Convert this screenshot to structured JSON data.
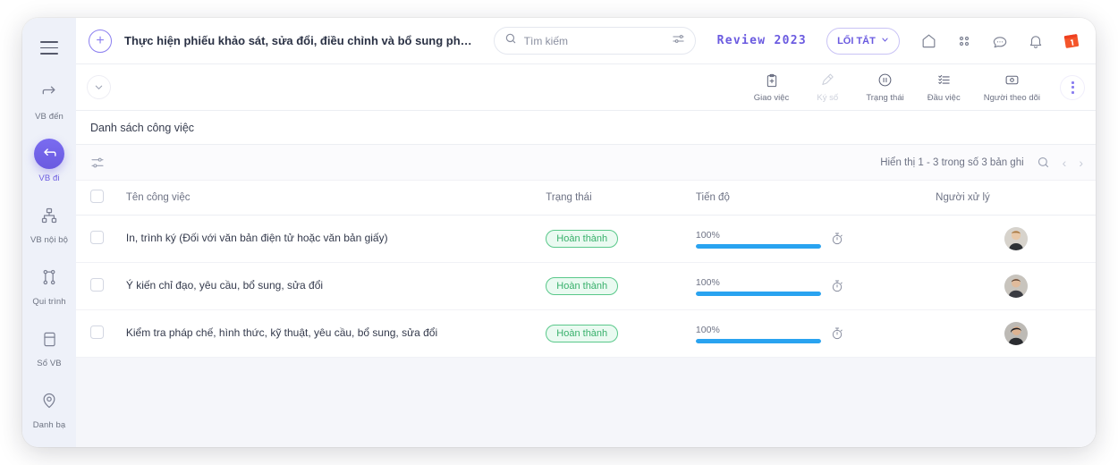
{
  "sidebar": {
    "menu_icon": "hamburger-icon",
    "items": [
      {
        "label": "VB đến",
        "icon": "arrow-right-icon",
        "active": false
      },
      {
        "label": "VB đi",
        "icon": "arrow-left-icon",
        "active": true
      },
      {
        "label": "VB nội bộ",
        "icon": "org-chart-icon",
        "active": false
      },
      {
        "label": "Qui trình",
        "icon": "workflow-icon",
        "active": false
      },
      {
        "label": "Sổ VB",
        "icon": "book-icon",
        "active": false
      },
      {
        "label": "Danh bạ",
        "icon": "location-pin-icon",
        "active": false
      }
    ]
  },
  "topbar": {
    "add_button": "+",
    "document_title": "Thực hiện phiếu khảo sát, sửa đổi, điều chỉnh và bổ sung ph…",
    "search": {
      "placeholder": "Tìm kiếm",
      "value": "",
      "icon": "search-icon",
      "filter_icon": "sliders-icon"
    },
    "brand": "Review 2023",
    "shortcut_button": "LỐI TẮT",
    "shortcut_caret": "⌄",
    "icons": [
      "home-icon",
      "apps-grid-icon",
      "chat-icon",
      "bell-icon",
      "calendar-logo-icon"
    ]
  },
  "actionbar": {
    "collapse_icon": "chevron-down-icon",
    "actions": [
      {
        "label": "Giao việc",
        "icon": "clipboard-plus-icon",
        "disabled": false
      },
      {
        "label": "Ký số",
        "icon": "signature-icon",
        "disabled": true
      },
      {
        "label": "Trạng thái",
        "icon": "pause-circle-icon",
        "disabled": false
      },
      {
        "label": "Đầu việc",
        "icon": "checklist-icon",
        "disabled": false
      },
      {
        "label": "Người theo dõi",
        "icon": "follower-icon",
        "disabled": false
      }
    ],
    "more_icon": "kebab-menu-icon"
  },
  "panel": {
    "title": "Danh sách công việc",
    "toolbar": {
      "filter_icon": "filter-sliders-icon",
      "record_count": "Hiển thị 1 - 3 trong số 3 bản ghi",
      "search_icon": "search-icon",
      "prev_icon": "‹",
      "next_icon": "›"
    },
    "table": {
      "columns": [
        "Tên công việc",
        "Trạng thái",
        "Tiến độ",
        "Người xử lý"
      ],
      "rows": [
        {
          "name": "In, trình ký (Đối với văn bản điện tử hoặc văn bản giấy)",
          "status": "Hoàn thành",
          "progress_label": "100%",
          "progress_value": 100,
          "assignee": "avatar-1"
        },
        {
          "name": "Ý kiến chỉ đạo, yêu cầu, bổ sung, sửa đổi",
          "status": "Hoàn thành",
          "progress_label": "100%",
          "progress_value": 100,
          "assignee": "avatar-2"
        },
        {
          "name": "Kiểm tra pháp chế, hình thức, kỹ thuật, yêu cầu, bổ sung, sửa đổi",
          "status": "Hoàn thành",
          "progress_label": "100%",
          "progress_value": 100,
          "assignee": "avatar-3"
        }
      ]
    }
  },
  "colors": {
    "accent": "#6a5ae0",
    "sidebar_bg": "#eef1f9",
    "status_green": "#38b06b",
    "progress_blue": "#29a3f0",
    "content_bg": "#f5f6fa",
    "logo_orange": "#f4552a"
  }
}
